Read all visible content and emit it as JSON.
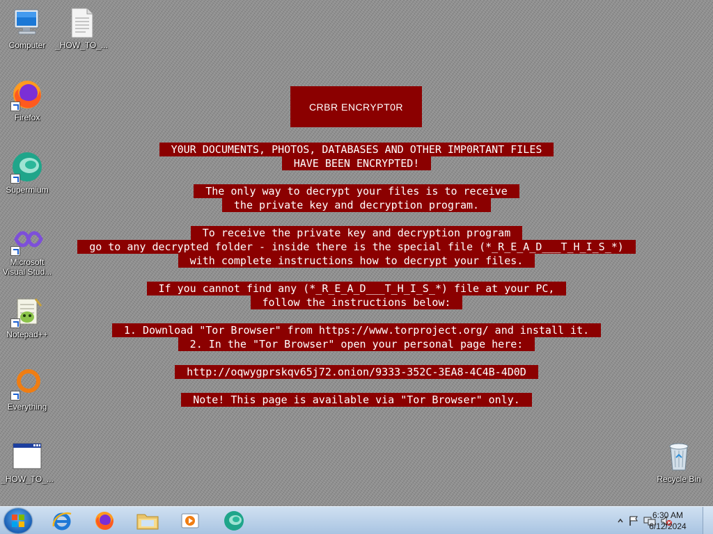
{
  "desktop": {
    "icons": [
      {
        "label": "Computer",
        "icon": "computer-icon"
      },
      {
        "label": "_HOW_TO_...",
        "icon": "text-file-icon"
      },
      {
        "label": "Firefox",
        "icon": "firefox-icon"
      },
      {
        "label": "Supermium",
        "icon": "supermium-icon"
      },
      {
        "label": "Microsoft Visual Stud...",
        "icon": "visual-studio-icon"
      },
      {
        "label": "Notepad++",
        "icon": "notepadpp-icon"
      },
      {
        "label": "Everything",
        "icon": "everything-icon"
      },
      {
        "label": "_HOW_TO_...",
        "icon": "window-file-icon"
      },
      {
        "label": "Recycle Bin",
        "icon": "recycle-bin-icon"
      }
    ]
  },
  "note": {
    "title": "CRBR ENCRYPT0R",
    "lines": [
      "Y0UR DOCUMENTS, PHOTOS, DATABASES AND OTHER IMP0RTANT FILES",
      "HAVE BEEN ENCRYPTED!",
      "The only way to decrypt your files is to receive",
      "the private key and decryption program.",
      "To receive the private key and decryption program",
      "go to any decrypted folder - inside there is the special file (*_R_E_A_D___T_H_I_S_*)",
      "with complete instructions how to decrypt your files.",
      "If you cannot find any (*_R_E_A_D___T_H_I_S_*) file at your PC,",
      "follow the instructions below:",
      "1. Download \"Tor Browser\" from https://www.torproject.org/ and install it.",
      "2. In the \"Tor Browser\" open your personal page here:",
      "http://oqwygprskqv65j72.onion/9333-352C-3EA8-4C4B-4D0D",
      "Note! This page is available via \"Tor Browser\" only."
    ]
  },
  "taskbar": {
    "pinned": [
      "internet-explorer-icon",
      "firefox-icon",
      "file-explorer-icon",
      "media-player-icon",
      "supermium-icon"
    ],
    "tray_icons": [
      "show-hidden-icons-chevron",
      "action-center-flag-icon",
      "network-icon",
      "volume-muted-icon"
    ],
    "time": "6:30 AM",
    "date": "6/12/2024"
  },
  "colors": {
    "note_background": "#8b0000",
    "desktop_background": "#8d8d8d",
    "taskbar": "#b9d0ea"
  }
}
